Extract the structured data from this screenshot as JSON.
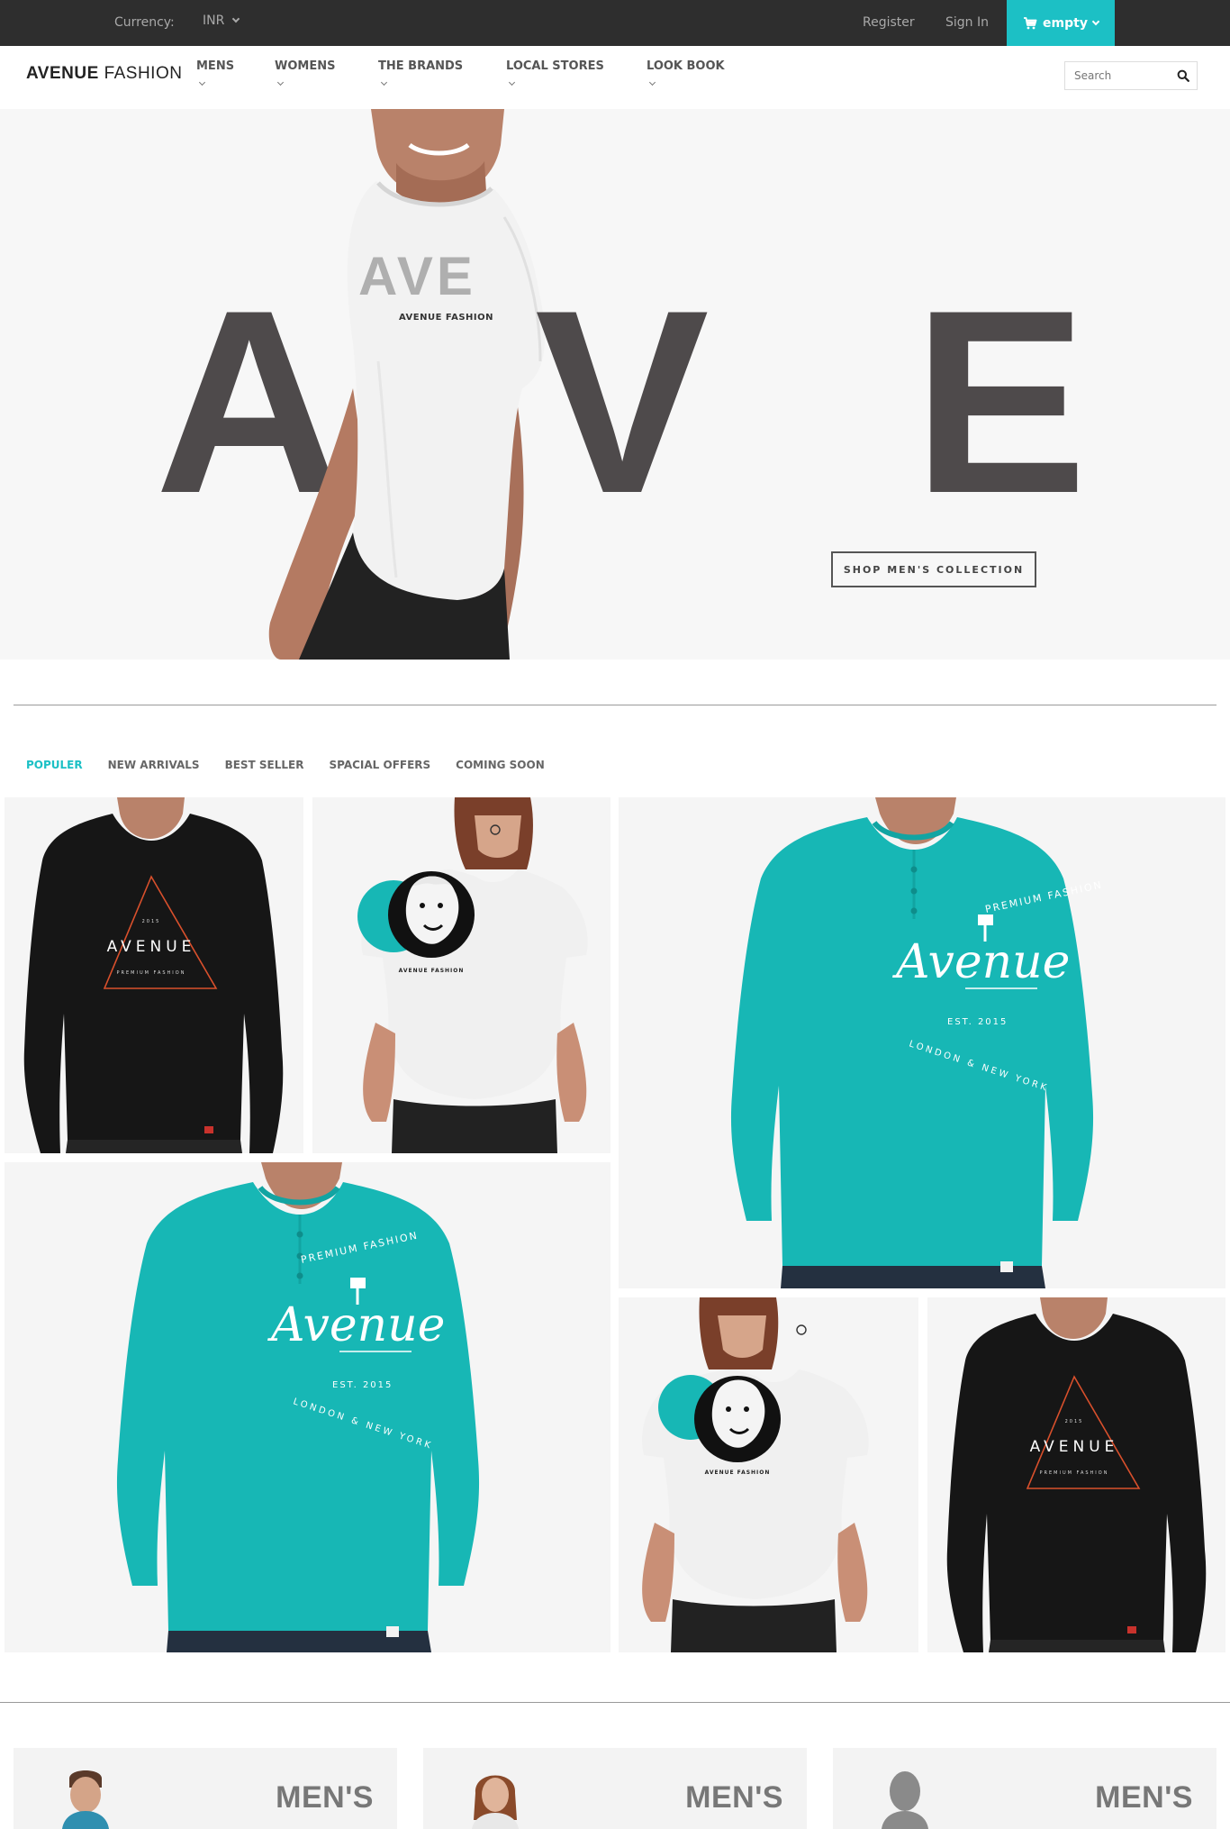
{
  "topbar": {
    "currency_label": "Currency:",
    "currency_value": "INR",
    "register": "Register",
    "sign_in": "Sign In",
    "cart_label": "empty"
  },
  "header": {
    "logo_strong": "AVENUE",
    "logo_light": "FASHION",
    "nav": [
      "MENS",
      "WOMENS",
      "THE BRANDS",
      "LOCAL STORES",
      "LOOK BOOK"
    ],
    "search_placeholder": "Search"
  },
  "hero": {
    "letters": [
      "A",
      "V",
      "E"
    ],
    "shirt_text": "AVE",
    "shirt_brand": "AVENUE FASHION",
    "cta": "SHOP MEN'S COLLECTION"
  },
  "tabs": [
    "POPULER",
    "NEW ARRIVALS",
    "BEST SELLER",
    "SPACIAL OFFERS",
    "COMING SOON"
  ],
  "products": {
    "avenue_tee": {
      "year": "2015",
      "brand": "AVENUE",
      "tagline": "PREMIUM FASHION"
    },
    "henley": {
      "arc_top": "PREMIUM FASHION",
      "script": "Avenue",
      "est": "EST. 2015",
      "arc_bottom": "LONDON & NEW YORK"
    },
    "womens_tee": {
      "brand": "AVENUE FASHION"
    }
  },
  "categories": [
    "MEN'S",
    "MEN'S",
    "MEN'S"
  ],
  "colors": {
    "accent": "#1cc0c5",
    "topbar": "#2e2e2e",
    "hero_letters": "#4e4a4b",
    "teal_shirt": "#17b7b5",
    "black_shirt": "#161616",
    "triangle": "#d9502c"
  }
}
